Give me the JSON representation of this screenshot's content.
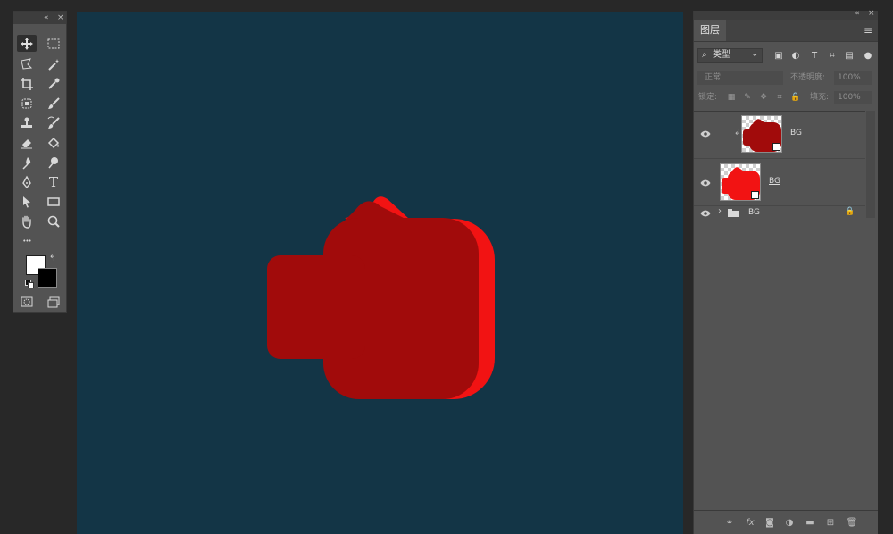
{
  "toolbar": {
    "collapse_glyph": "«",
    "close_glyph": "×",
    "tools": [
      {
        "name": "move-tool",
        "icon": "move-icon",
        "active": true
      },
      {
        "name": "marquee-tool",
        "icon": "rectangular-marquee-icon"
      },
      {
        "name": "lasso-tool",
        "icon": "polygonal-lasso-icon"
      },
      {
        "name": "magic-wand-tool",
        "icon": "magic-wand-icon"
      },
      {
        "name": "crop-tool",
        "icon": "crop-icon"
      },
      {
        "name": "eyedropper-tool",
        "icon": "eyedropper-icon"
      },
      {
        "name": "healing-brush-tool",
        "icon": "healing-brush-icon"
      },
      {
        "name": "brush-tool",
        "icon": "brush-icon"
      },
      {
        "name": "clone-stamp-tool",
        "icon": "clone-stamp-icon"
      },
      {
        "name": "history-brush-tool",
        "icon": "history-brush-icon"
      },
      {
        "name": "eraser-tool",
        "icon": "eraser-icon"
      },
      {
        "name": "paint-bucket-tool",
        "icon": "paint-bucket-icon"
      },
      {
        "name": "blur-tool",
        "icon": "blur-icon"
      },
      {
        "name": "dodge-tool",
        "icon": "dodge-icon"
      },
      {
        "name": "pen-tool",
        "icon": "pen-icon"
      },
      {
        "name": "type-tool",
        "icon": "type-icon",
        "glyph": "T"
      },
      {
        "name": "path-selection-tool",
        "icon": "path-selection-icon"
      },
      {
        "name": "rectangle-tool",
        "icon": "rectangle-shape-icon"
      },
      {
        "name": "hand-tool",
        "icon": "hand-icon"
      },
      {
        "name": "zoom-tool",
        "icon": "zoom-icon"
      },
      {
        "name": "edit-toolbar",
        "icon": "more-dots-icon",
        "glyph": "•••"
      }
    ],
    "foreground_color": "#ffffff",
    "background_color": "#000000"
  },
  "canvas": {
    "background_color": "#133546",
    "shape_color": "#a10b0b",
    "shadow_color": "#f21313"
  },
  "layers_panel": {
    "tab_label": "图层",
    "menu_glyph": "≡",
    "filter": {
      "search_glyph": "⌕",
      "label": "类型",
      "arrow_glyph": "⌄",
      "icon_glyphs": [
        "▣",
        "◐",
        "T",
        "⌗",
        "▤",
        "●"
      ]
    },
    "blend_mode": "正常",
    "opacity_label": "不透明度:",
    "opacity_value": "100%",
    "lock_label": "锁定:",
    "lock_glyphs": [
      "▦",
      "✎",
      "✥",
      "⌗",
      "🔒"
    ],
    "fill_label": "填充:",
    "fill_value": "100%",
    "layers": [
      {
        "name": "BG",
        "clipped": true,
        "clip_glyph": "↲"
      },
      {
        "name": "BG",
        "clipped": false
      },
      {
        "name": "BG",
        "type": "group",
        "expand_glyph": "›",
        "lock_glyph": "🔒"
      }
    ],
    "footer_glyphs": [
      "⚭",
      "fx",
      "◙",
      "◑",
      "▬",
      "⊞",
      "🗑"
    ]
  }
}
